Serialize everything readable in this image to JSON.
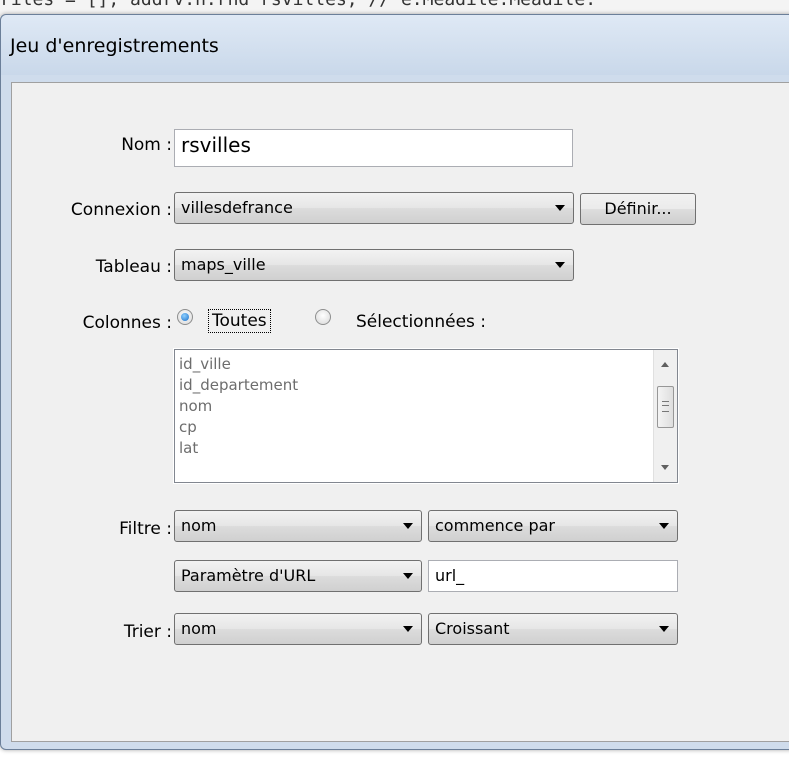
{
  "background_code": "riles = [], addrv.n.rnd rsvilles; // e.Meadile.Meadile.",
  "dialog": {
    "title": "Jeu d'enregistrements"
  },
  "form": {
    "name": {
      "label": "Nom :",
      "value": "rsvilles"
    },
    "connection": {
      "label": "Connexion :",
      "value": "villesdefrance",
      "button_label": "Définir..."
    },
    "table": {
      "label": "Tableau :",
      "value": "maps_ville"
    },
    "columns": {
      "label": "Colonnes :",
      "option_all": "Toutes",
      "option_selected": "Sélectionnées :",
      "selected_option": "Toutes",
      "items": [
        "id_ville",
        "id_departement",
        "nom",
        "cp",
        "lat"
      ]
    },
    "filter": {
      "label": "Filtre :",
      "column": "nom",
      "operator": "commence par",
      "source": "Paramètre d'URL",
      "value": "url_"
    },
    "sort": {
      "label": "Trier :",
      "column": "nom",
      "order": "Croissant"
    }
  }
}
